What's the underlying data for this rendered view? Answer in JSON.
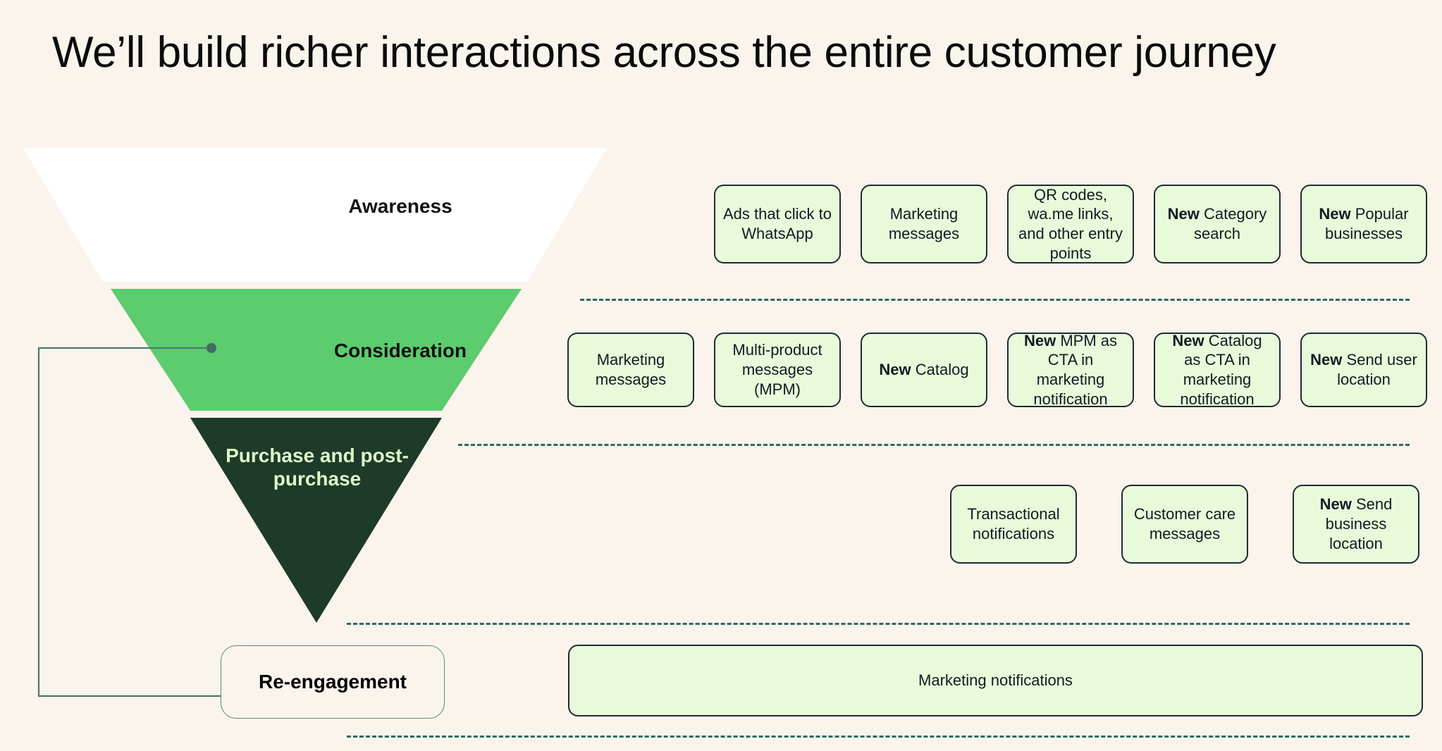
{
  "slide": {
    "title": "We’ll build richer interactions across the entire customer journey",
    "background_color": "#faf4ed"
  },
  "funnel": {
    "stages": [
      {
        "name": "awareness",
        "label": "Awareness",
        "fill_color": "#ffffff",
        "text_color": "#111111"
      },
      {
        "name": "consideration",
        "label": "Consideration",
        "fill_color": "#5ccc6e",
        "text_color": "#111111"
      },
      {
        "name": "purchase",
        "label": "Purchase and post-purchase",
        "fill_color": "#1e3a28",
        "text_color": "#ddf8c9"
      },
      {
        "name": "reengagement",
        "label": "Re-engagement",
        "fill_color": "transparent",
        "text_color": "#000000",
        "border_color": "#5f8a6e"
      }
    ],
    "connector_color": "#4a7a6b"
  },
  "rows": {
    "awareness": {
      "cards": [
        {
          "new": "",
          "text": "Ads that click to WhatsApp"
        },
        {
          "new": "",
          "text": "Marketing messages"
        },
        {
          "new": "",
          "text": "QR codes, wa.me links, and other entry points"
        },
        {
          "new": "New",
          "text": " Category search"
        },
        {
          "new": "New",
          "text": " Popular businesses"
        }
      ]
    },
    "consideration": {
      "cards": [
        {
          "new": "",
          "text": "Marketing messages"
        },
        {
          "new": "",
          "text": "Multi-product messages (MPM)"
        },
        {
          "new": "New",
          "text": " Catalog"
        },
        {
          "new": "New",
          "text": " MPM as CTA in marketing notification"
        },
        {
          "new": "New",
          "text": " Catalog as CTA in marketing notification"
        },
        {
          "new": "New",
          "text": " Send user location"
        }
      ]
    },
    "purchase": {
      "cards": [
        {
          "new": "",
          "text": "Transactional notifications"
        },
        {
          "new": "",
          "text": "Customer care messages"
        },
        {
          "new": "New",
          "text": " Send business location"
        }
      ]
    },
    "reengagement": {
      "cards": [
        {
          "new": "",
          "text": "Marketing notifications"
        }
      ]
    }
  },
  "colors": {
    "card_fill": "#e8fada",
    "card_border": "#1f2b33",
    "divider": "#2f6b5e",
    "funnel_green": "#5ccc6e",
    "funnel_dark": "#1e3a28"
  }
}
